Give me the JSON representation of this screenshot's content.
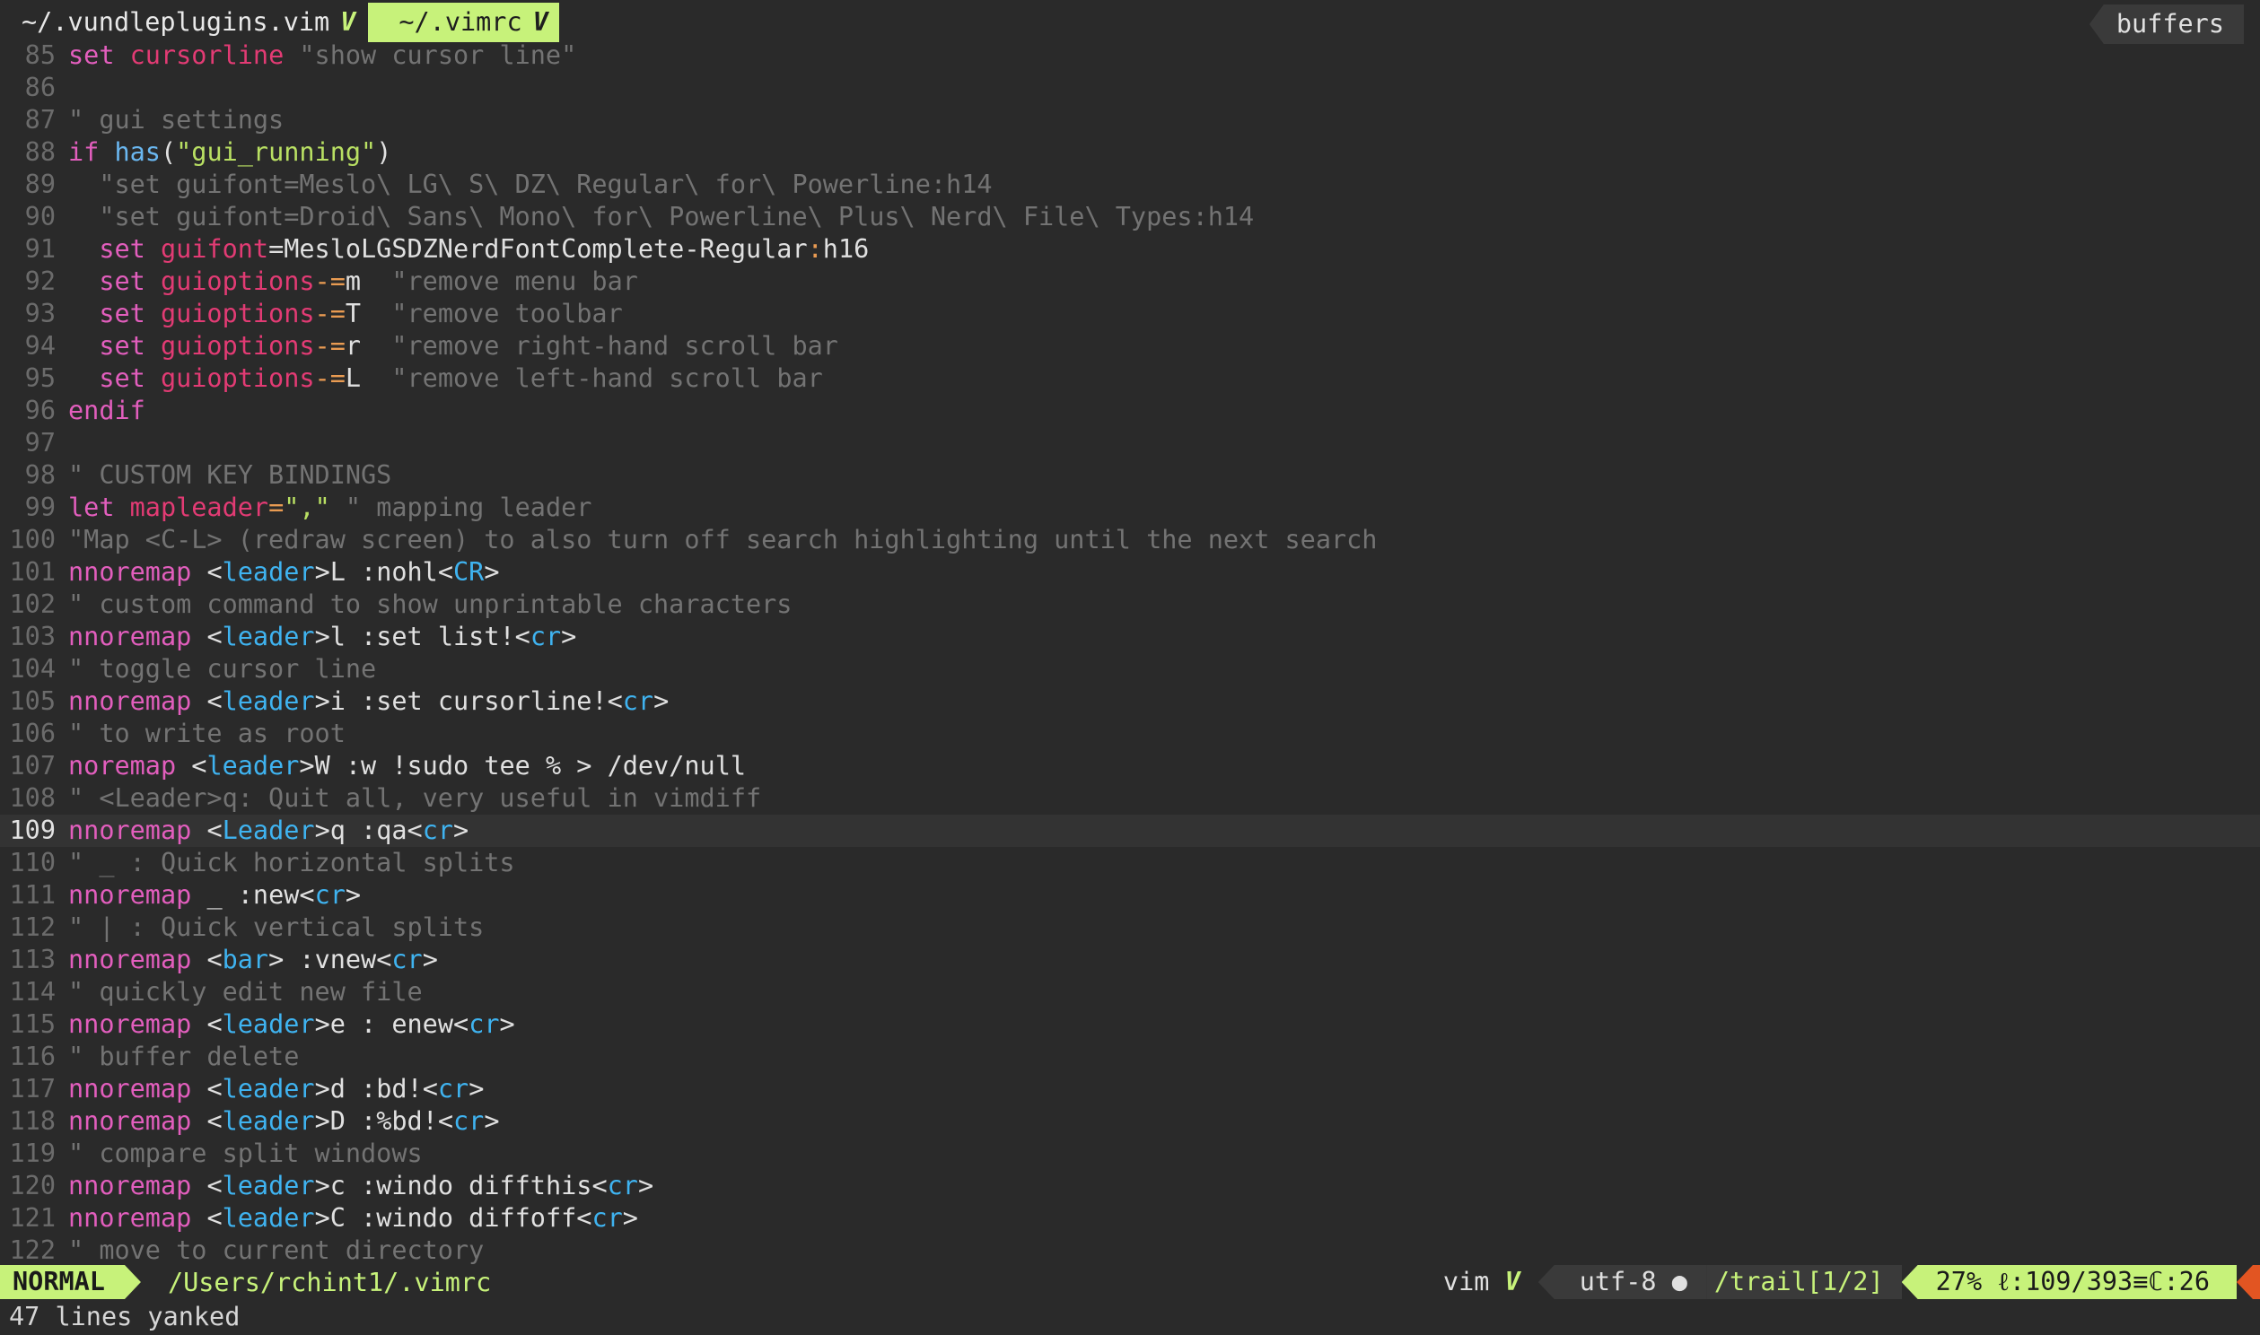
{
  "tabline": {
    "tabs": [
      {
        "label": "~/.vundleplugins.vim",
        "marker": "V",
        "active": false
      },
      {
        "label": "~/.vimrc",
        "marker": "V",
        "active": true
      }
    ],
    "buffers_label": "buffers"
  },
  "editor": {
    "cursor_line": 109,
    "lines": [
      {
        "num": "85",
        "tokens": [
          [
            "kw",
            "set "
          ],
          [
            "opt",
            "cursorline "
          ],
          [
            "cmt",
            "\"show cursor line\""
          ]
        ]
      },
      {
        "num": "86",
        "tokens": []
      },
      {
        "num": "87",
        "tokens": [
          [
            "cmt",
            "\" gui settings"
          ]
        ]
      },
      {
        "num": "88",
        "tokens": [
          [
            "kw",
            "if "
          ],
          [
            "fn",
            "has"
          ],
          [
            "pl",
            "("
          ],
          [
            "str",
            "\"gui_running\""
          ],
          [
            "pl",
            ")"
          ]
        ]
      },
      {
        "num": "89",
        "tokens": [
          [
            "cmt",
            "  \"set guifont=Meslo\\ LG\\ S\\ DZ\\ Regular\\ for\\ Powerline:h14"
          ]
        ]
      },
      {
        "num": "90",
        "tokens": [
          [
            "cmt",
            "  \"set guifont=Droid\\ Sans\\ Mono\\ for\\ Powerline\\ Plus\\ Nerd\\ File\\ Types:h14"
          ]
        ]
      },
      {
        "num": "91",
        "tokens": [
          [
            "kw",
            "  set "
          ],
          [
            "opt",
            "guifont"
          ],
          [
            "pl",
            "=MesloLGSDZNerdFontComplete-Regular"
          ],
          [
            "op",
            ":"
          ],
          [
            "pl",
            "h16"
          ]
        ]
      },
      {
        "num": "92",
        "tokens": [
          [
            "kw",
            "  set "
          ],
          [
            "opt",
            "guioptions"
          ],
          [
            "op",
            "-="
          ],
          [
            "pl",
            "m  "
          ],
          [
            "cmt",
            "\"remove menu bar"
          ]
        ]
      },
      {
        "num": "93",
        "tokens": [
          [
            "kw",
            "  set "
          ],
          [
            "opt",
            "guioptions"
          ],
          [
            "op",
            "-="
          ],
          [
            "pl",
            "T  "
          ],
          [
            "cmt",
            "\"remove toolbar"
          ]
        ]
      },
      {
        "num": "94",
        "tokens": [
          [
            "kw",
            "  set "
          ],
          [
            "opt",
            "guioptions"
          ],
          [
            "op",
            "-="
          ],
          [
            "pl",
            "r  "
          ],
          [
            "cmt",
            "\"remove right-hand scroll bar"
          ]
        ]
      },
      {
        "num": "95",
        "tokens": [
          [
            "kw",
            "  set "
          ],
          [
            "opt",
            "guioptions"
          ],
          [
            "op",
            "-="
          ],
          [
            "pl",
            "L  "
          ],
          [
            "cmt",
            "\"remove left-hand scroll bar"
          ]
        ]
      },
      {
        "num": "96",
        "tokens": [
          [
            "kw",
            "endif"
          ]
        ]
      },
      {
        "num": "97",
        "tokens": []
      },
      {
        "num": "98",
        "tokens": [
          [
            "cmt",
            "\" CUSTOM KEY BINDINGS"
          ]
        ]
      },
      {
        "num": "99",
        "tokens": [
          [
            "kw",
            "let "
          ],
          [
            "opt",
            "mapleader"
          ],
          [
            "op",
            "="
          ],
          [
            "str",
            "\",\" "
          ],
          [
            "cmt",
            "\" mapping leader"
          ]
        ]
      },
      {
        "num": "100",
        "tokens": [
          [
            "cmt",
            "\"Map <C-L> (redraw screen) to also turn off search highlighting until the next search"
          ]
        ]
      },
      {
        "num": "101",
        "tokens": [
          [
            "kw",
            "nnoremap "
          ],
          [
            "ang",
            "<"
          ],
          [
            "tag",
            "leader"
          ],
          [
            "ang",
            ">"
          ],
          [
            "pl",
            "L :nohl"
          ],
          [
            "ang",
            "<"
          ],
          [
            "tag",
            "CR"
          ],
          [
            "ang",
            ">"
          ]
        ]
      },
      {
        "num": "102",
        "tokens": [
          [
            "cmt",
            "\" custom command to show unprintable characters"
          ]
        ]
      },
      {
        "num": "103",
        "tokens": [
          [
            "kw",
            "nnoremap "
          ],
          [
            "ang",
            "<"
          ],
          [
            "tag",
            "leader"
          ],
          [
            "ang",
            ">"
          ],
          [
            "pl",
            "l :set list!"
          ],
          [
            "ang",
            "<"
          ],
          [
            "tag",
            "cr"
          ],
          [
            "ang",
            ">"
          ]
        ]
      },
      {
        "num": "104",
        "tokens": [
          [
            "cmt",
            "\" toggle cursor line"
          ]
        ]
      },
      {
        "num": "105",
        "tokens": [
          [
            "kw",
            "nnoremap "
          ],
          [
            "ang",
            "<"
          ],
          [
            "tag",
            "leader"
          ],
          [
            "ang",
            ">"
          ],
          [
            "pl",
            "i :set cursorline!"
          ],
          [
            "ang",
            "<"
          ],
          [
            "tag",
            "cr"
          ],
          [
            "ang",
            ">"
          ]
        ]
      },
      {
        "num": "106",
        "tokens": [
          [
            "cmt",
            "\" to write as root"
          ]
        ]
      },
      {
        "num": "107",
        "tokens": [
          [
            "kw",
            "noremap "
          ],
          [
            "ang",
            "<"
          ],
          [
            "tag",
            "leader"
          ],
          [
            "ang",
            ">"
          ],
          [
            "pl",
            "W :w !sudo tee % > /dev/null"
          ]
        ]
      },
      {
        "num": "108",
        "tokens": [
          [
            "cmt",
            "\" <Leader>q: Quit all, very useful in vimdiff"
          ]
        ]
      },
      {
        "num": "109",
        "tokens": [
          [
            "kw",
            "nnoremap "
          ],
          [
            "ang",
            "<"
          ],
          [
            "tag",
            "Leader"
          ],
          [
            "ang",
            ">"
          ],
          [
            "pl",
            "q :qa"
          ],
          [
            "ang",
            "<"
          ],
          [
            "tag",
            "cr"
          ],
          [
            "ang",
            ">"
          ]
        ]
      },
      {
        "num": "110",
        "tokens": [
          [
            "cmt",
            "\" _ : Quick horizontal splits"
          ]
        ]
      },
      {
        "num": "111",
        "tokens": [
          [
            "kw",
            "nnoremap "
          ],
          [
            "pl",
            "_ :new"
          ],
          [
            "ang",
            "<"
          ],
          [
            "tag",
            "cr"
          ],
          [
            "ang",
            ">"
          ]
        ]
      },
      {
        "num": "112",
        "tokens": [
          [
            "cmt",
            "\" | : Quick vertical splits"
          ]
        ]
      },
      {
        "num": "113",
        "tokens": [
          [
            "kw",
            "nnoremap "
          ],
          [
            "ang",
            "<"
          ],
          [
            "tag",
            "bar"
          ],
          [
            "ang",
            ">"
          ],
          [
            "pl",
            " :vnew"
          ],
          [
            "ang",
            "<"
          ],
          [
            "tag",
            "cr"
          ],
          [
            "ang",
            ">"
          ]
        ]
      },
      {
        "num": "114",
        "tokens": [
          [
            "cmt",
            "\" quickly edit new file"
          ]
        ]
      },
      {
        "num": "115",
        "tokens": [
          [
            "kw",
            "nnoremap "
          ],
          [
            "ang",
            "<"
          ],
          [
            "tag",
            "leader"
          ],
          [
            "ang",
            ">"
          ],
          [
            "pl",
            "e : enew"
          ],
          [
            "ang",
            "<"
          ],
          [
            "tag",
            "cr"
          ],
          [
            "ang",
            ">"
          ]
        ]
      },
      {
        "num": "116",
        "tokens": [
          [
            "cmt",
            "\" buffer delete"
          ]
        ]
      },
      {
        "num": "117",
        "tokens": [
          [
            "kw",
            "nnoremap "
          ],
          [
            "ang",
            "<"
          ],
          [
            "tag",
            "leader"
          ],
          [
            "ang",
            ">"
          ],
          [
            "pl",
            "d :bd!"
          ],
          [
            "ang",
            "<"
          ],
          [
            "tag",
            "cr"
          ],
          [
            "ang",
            ">"
          ]
        ]
      },
      {
        "num": "118",
        "tokens": [
          [
            "kw",
            "nnoremap "
          ],
          [
            "ang",
            "<"
          ],
          [
            "tag",
            "leader"
          ],
          [
            "ang",
            ">"
          ],
          [
            "pl",
            "D :%bd!"
          ],
          [
            "ang",
            "<"
          ],
          [
            "tag",
            "cr"
          ],
          [
            "ang",
            ">"
          ]
        ]
      },
      {
        "num": "119",
        "tokens": [
          [
            "cmt",
            "\" compare split windows"
          ]
        ]
      },
      {
        "num": "120",
        "tokens": [
          [
            "kw",
            "nnoremap "
          ],
          [
            "ang",
            "<"
          ],
          [
            "tag",
            "leader"
          ],
          [
            "ang",
            ">"
          ],
          [
            "pl",
            "c :windo diffthis"
          ],
          [
            "ang",
            "<"
          ],
          [
            "tag",
            "cr"
          ],
          [
            "ang",
            ">"
          ]
        ]
      },
      {
        "num": "121",
        "tokens": [
          [
            "kw",
            "nnoremap "
          ],
          [
            "ang",
            "<"
          ],
          [
            "tag",
            "leader"
          ],
          [
            "ang",
            ">"
          ],
          [
            "pl",
            "C :windo diffoff"
          ],
          [
            "ang",
            "<"
          ],
          [
            "tag",
            "cr"
          ],
          [
            "ang",
            ">"
          ]
        ]
      },
      {
        "num": "122",
        "tokens": [
          [
            "cmt",
            "\" move to current directory"
          ]
        ]
      }
    ]
  },
  "statusline": {
    "mode": "NORMAL",
    "filepath": "/Users/rchint1/.vimrc",
    "filetype": "vim",
    "filetype_marker": "V",
    "encoding": "utf-8",
    "os_icon": "",
    "trail": "/trail[1/2]",
    "percent": "27%",
    "line_label": "ℓ:109/393≡",
    "col_label": "ℂ:26"
  },
  "cmdline": {
    "message": "47 lines yanked"
  },
  "colors": {
    "accent": "#c7f27a",
    "keyword": "#e25ebd",
    "option": "#e23b74",
    "function": "#6ab7f0",
    "string": "#b9e063",
    "comment": "#737373",
    "error_segment": "#e25522"
  }
}
